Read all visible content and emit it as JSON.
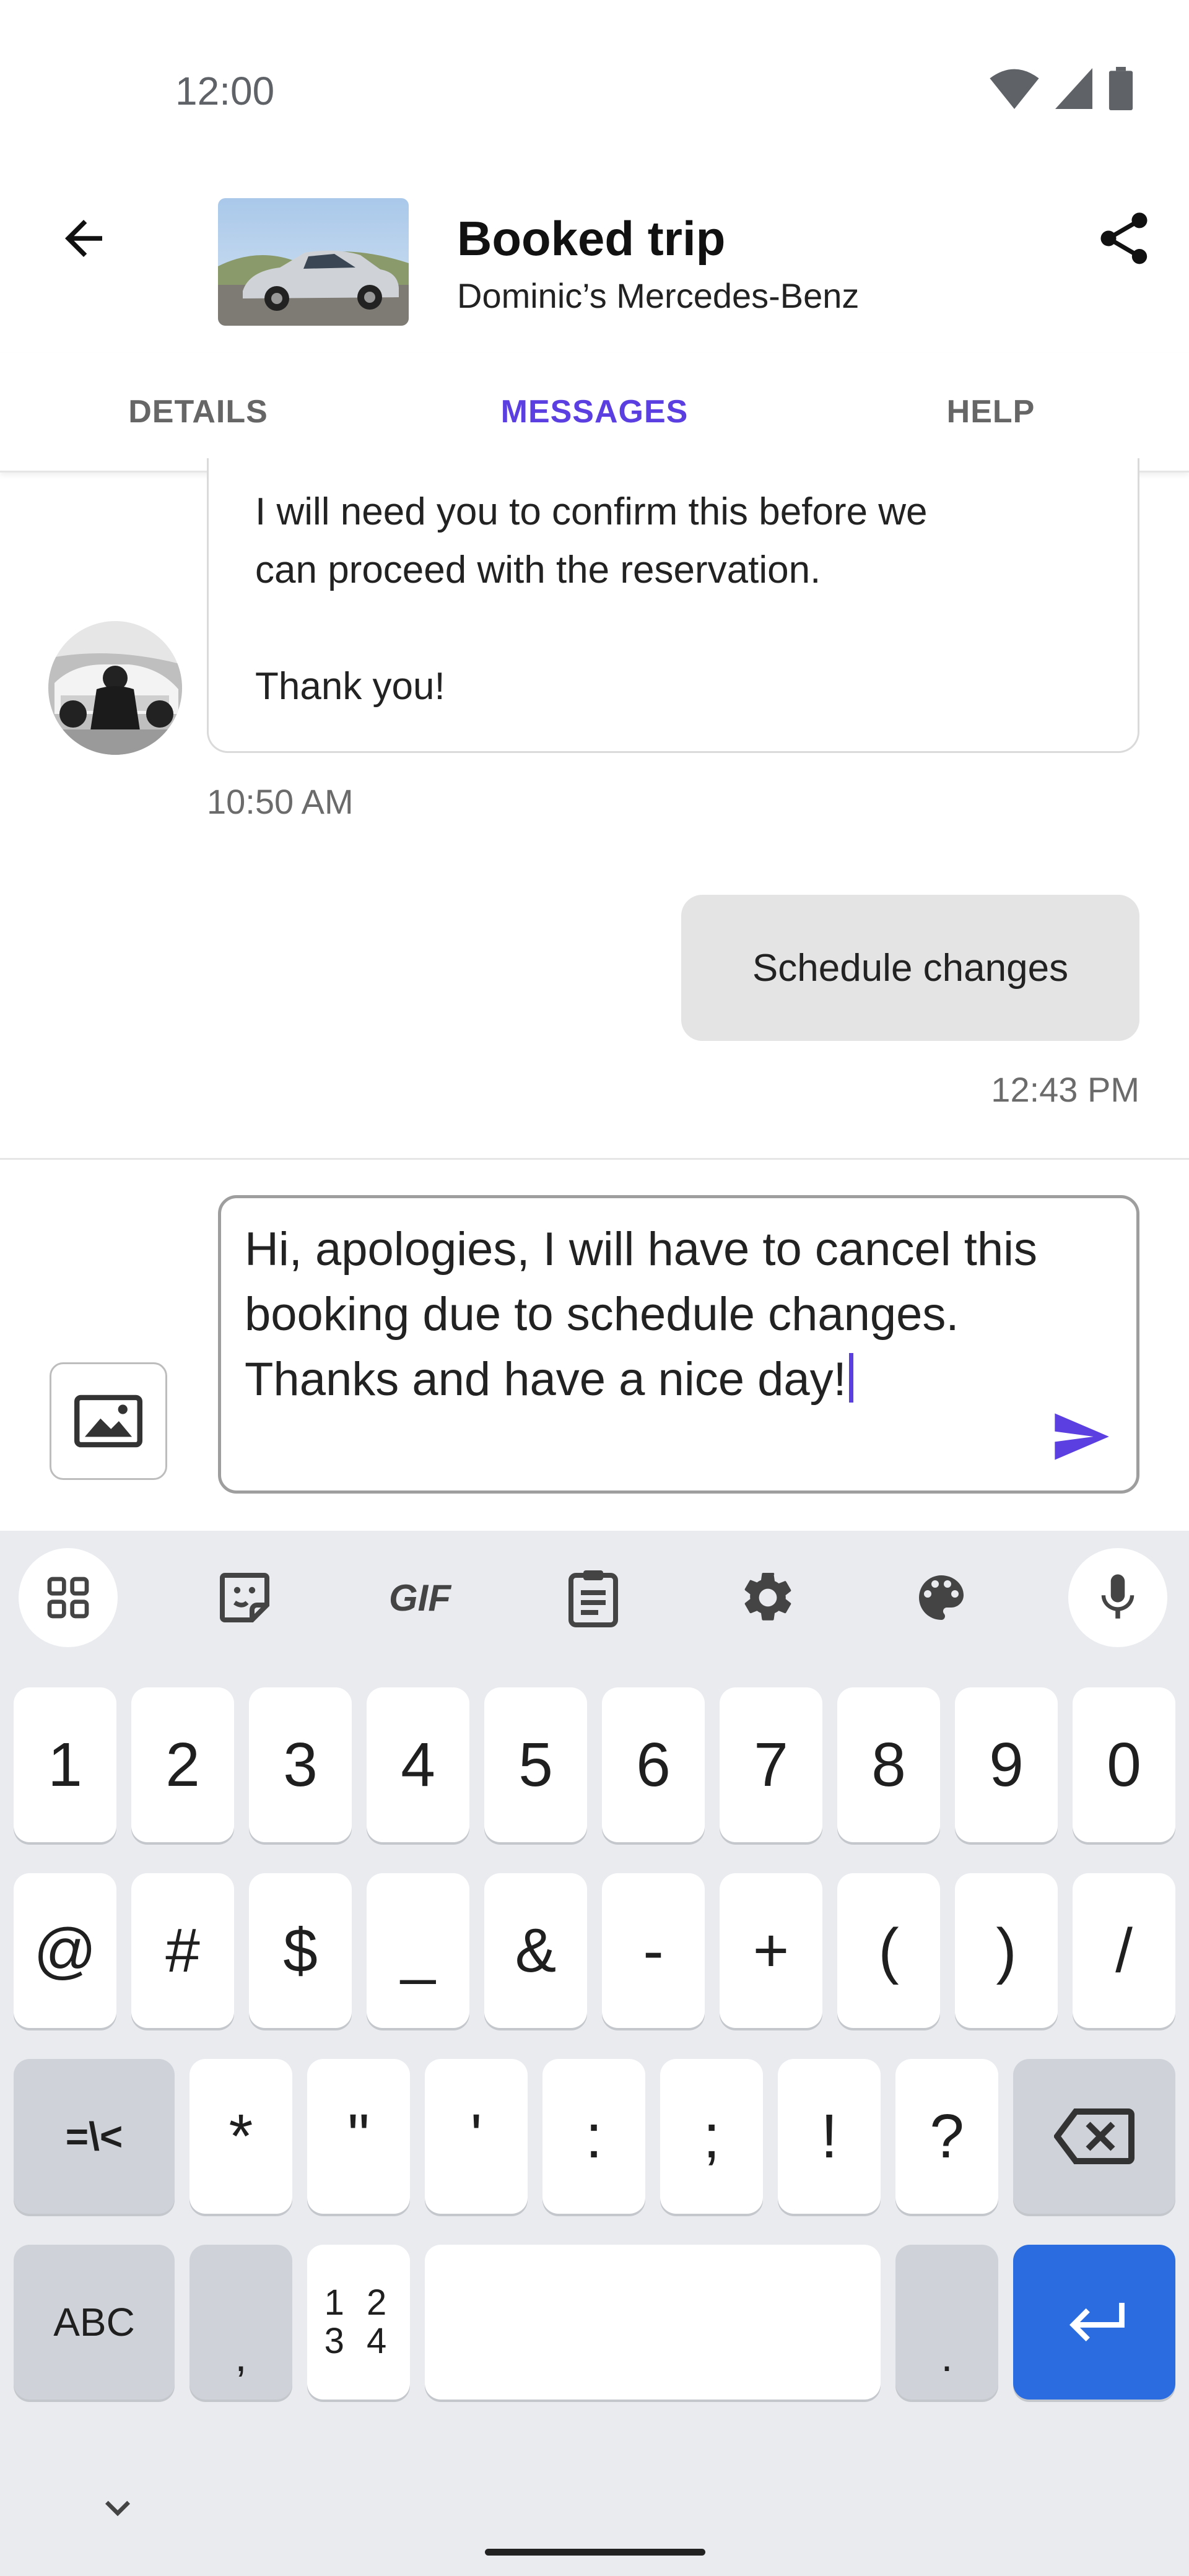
{
  "status_bar": {
    "time": "12:00"
  },
  "header": {
    "title": "Booked trip",
    "subtitle": "Dominic’s Mercedes-Benz"
  },
  "tabs": [
    {
      "label": "DETAILS",
      "active": false
    },
    {
      "label": "MESSAGES",
      "active": true
    },
    {
      "label": "HELP",
      "active": false
    }
  ],
  "messages": {
    "incoming": {
      "line1": "I will need you to confirm this before we",
      "line2": "can proceed with the reservation.",
      "line3": "Thank you!",
      "time": "10:50 AM"
    },
    "outgoing": {
      "text": "Schedule changes",
      "time": "12:43 PM"
    }
  },
  "compose": {
    "text": "Hi, apologies, I will have to cancel this booking due to schedule changes. Thanks and have a nice day!"
  },
  "keyboard": {
    "toolbar": [
      "apps-grid-icon",
      "sticker-icon",
      "GIF",
      "clipboard-icon",
      "settings-icon",
      "palette-icon",
      "mic-icon"
    ],
    "row1": [
      "1",
      "2",
      "3",
      "4",
      "5",
      "6",
      "7",
      "8",
      "9",
      "0"
    ],
    "row2": [
      "@",
      "#",
      "$",
      "_",
      "&",
      "-",
      "+",
      "(",
      ")",
      "/"
    ],
    "row3": [
      "=\\<",
      "*",
      "\"",
      "'",
      ":",
      ";",
      "!",
      "?"
    ],
    "row4": {
      "abc": "ABC",
      "comma": ",",
      "numpad_top": "1 2",
      "numpad_bottom": "3 4",
      "period": "."
    }
  },
  "colors": {
    "accent": "#5b3fe0",
    "enter_key": "#2b6de0"
  }
}
